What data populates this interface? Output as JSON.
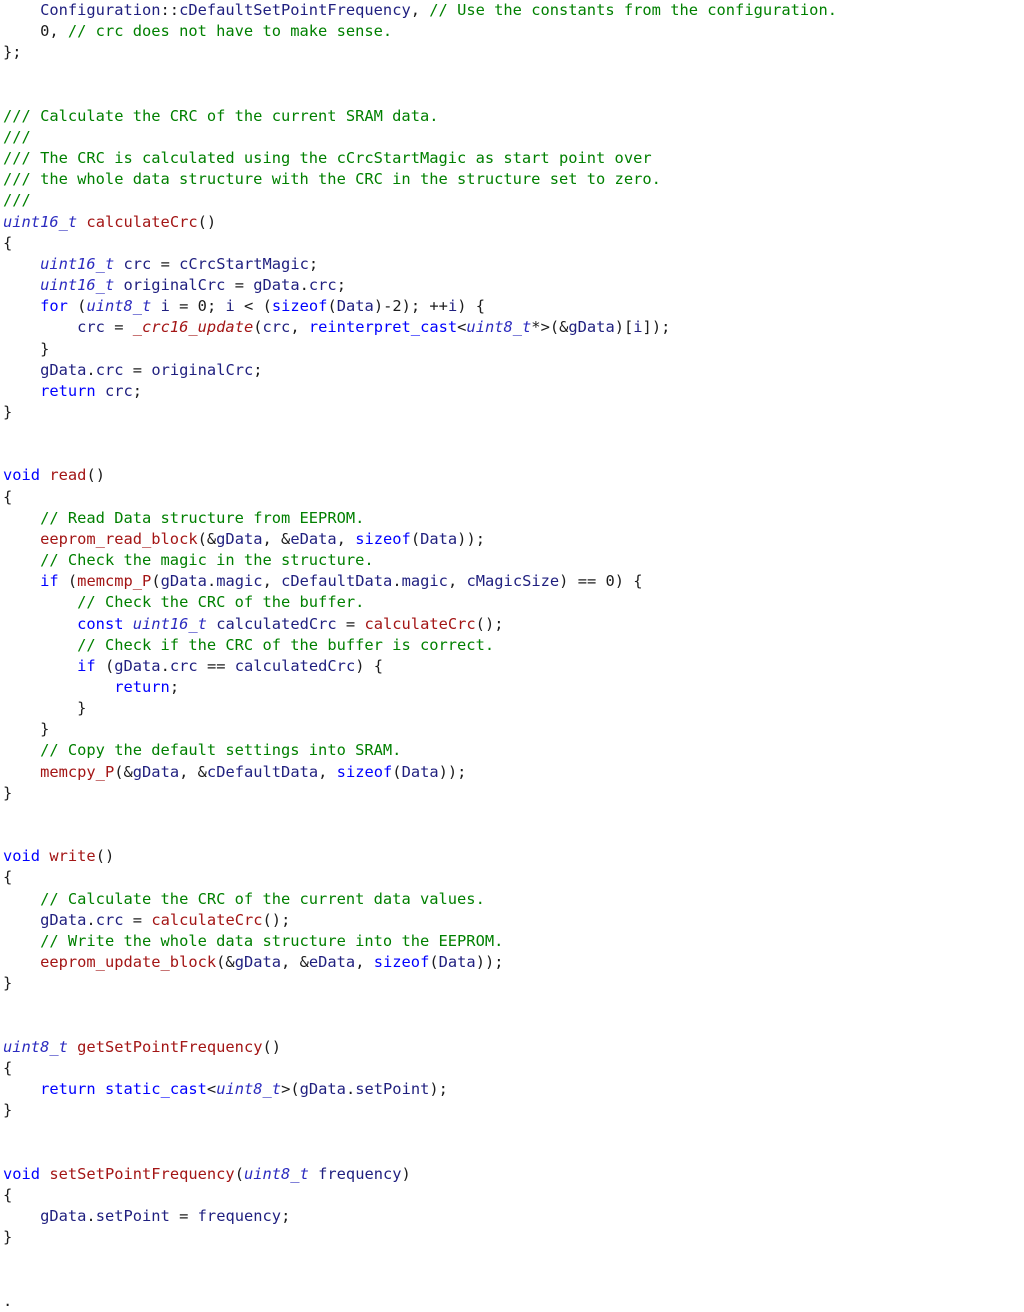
{
  "editor": {
    "title": "",
    "colors": {
      "plain": "#1c1c1c",
      "comment": "#008000",
      "keyword": "#0000ff",
      "type": "#2b2bbf",
      "function": "#a31515",
      "identifier": "#1f1f7f"
    },
    "lines": [
      [
        [
          "ident",
          "    Configuration"
        ],
        [
          "plain",
          "::"
        ],
        [
          "ident",
          "cDefaultSetPointFrequency"
        ],
        [
          "plain",
          ", "
        ],
        [
          "comment",
          "// Use the constants from the configuration."
        ]
      ],
      [
        [
          "plain",
          "    0, "
        ],
        [
          "comment",
          "// crc does not have to make sense."
        ]
      ],
      [
        [
          "plain",
          "};"
        ]
      ],
      [],
      [],
      [
        [
          "comment",
          "/// Calculate the CRC of the current SRAM data."
        ]
      ],
      [
        [
          "comment",
          "///"
        ]
      ],
      [
        [
          "comment",
          "/// The CRC is calculated using the cCrcStartMagic as start point over"
        ]
      ],
      [
        [
          "comment",
          "/// the whole data structure with the CRC in the structure set to zero."
        ]
      ],
      [
        [
          "comment",
          "///"
        ]
      ],
      [
        [
          "type",
          "uint16_t"
        ],
        [
          "plain",
          " "
        ],
        [
          "func",
          "calculateCrc"
        ],
        [
          "plain",
          "()"
        ]
      ],
      [
        [
          "plain",
          "{"
        ]
      ],
      [
        [
          "plain",
          "    "
        ],
        [
          "type",
          "uint16_t"
        ],
        [
          "plain",
          " "
        ],
        [
          "ident",
          "crc"
        ],
        [
          "plain",
          " = "
        ],
        [
          "ident",
          "cCrcStartMagic"
        ],
        [
          "plain",
          ";"
        ]
      ],
      [
        [
          "plain",
          "    "
        ],
        [
          "type",
          "uint16_t"
        ],
        [
          "plain",
          " "
        ],
        [
          "ident",
          "originalCrc"
        ],
        [
          "plain",
          " = "
        ],
        [
          "ident",
          "gData"
        ],
        [
          "plain",
          "."
        ],
        [
          "ident",
          "crc"
        ],
        [
          "plain",
          ";"
        ]
      ],
      [
        [
          "plain",
          "    "
        ],
        [
          "keyword",
          "for"
        ],
        [
          "plain",
          " ("
        ],
        [
          "type",
          "uint8_t"
        ],
        [
          "plain",
          " "
        ],
        [
          "ident",
          "i"
        ],
        [
          "plain",
          " = 0; "
        ],
        [
          "ident",
          "i"
        ],
        [
          "plain",
          " < ("
        ],
        [
          "keyword",
          "sizeof"
        ],
        [
          "plain",
          "("
        ],
        [
          "ident",
          "Data"
        ],
        [
          "plain",
          ")-2); ++"
        ],
        [
          "ident",
          "i"
        ],
        [
          "plain",
          ") {"
        ]
      ],
      [
        [
          "plain",
          "        "
        ],
        [
          "ident",
          "crc"
        ],
        [
          "plain",
          " = "
        ],
        [
          "funcit",
          "_crc16_update"
        ],
        [
          "plain",
          "("
        ],
        [
          "ident",
          "crc"
        ],
        [
          "plain",
          ", "
        ],
        [
          "keyword",
          "reinterpret_cast"
        ],
        [
          "plain",
          "<"
        ],
        [
          "type",
          "uint8_t"
        ],
        [
          "plain",
          "*>(&"
        ],
        [
          "ident",
          "gData"
        ],
        [
          "plain",
          ")["
        ],
        [
          "ident",
          "i"
        ],
        [
          "plain",
          "]);"
        ]
      ],
      [
        [
          "plain",
          "    }"
        ]
      ],
      [
        [
          "plain",
          "    "
        ],
        [
          "ident",
          "gData"
        ],
        [
          "plain",
          "."
        ],
        [
          "ident",
          "crc"
        ],
        [
          "plain",
          " = "
        ],
        [
          "ident",
          "originalCrc"
        ],
        [
          "plain",
          ";"
        ]
      ],
      [
        [
          "plain",
          "    "
        ],
        [
          "keyword",
          "return"
        ],
        [
          "plain",
          " "
        ],
        [
          "ident",
          "crc"
        ],
        [
          "plain",
          ";"
        ]
      ],
      [
        [
          "plain",
          "}"
        ]
      ],
      [],
      [],
      [
        [
          "keyword",
          "void"
        ],
        [
          "plain",
          " "
        ],
        [
          "func",
          "read"
        ],
        [
          "plain",
          "()"
        ]
      ],
      [
        [
          "plain",
          "{"
        ]
      ],
      [
        [
          "plain",
          "    "
        ],
        [
          "comment",
          "// Read Data structure from EEPROM."
        ]
      ],
      [
        [
          "plain",
          "    "
        ],
        [
          "func",
          "eeprom_read_block"
        ],
        [
          "plain",
          "(&"
        ],
        [
          "ident",
          "gData"
        ],
        [
          "plain",
          ", &"
        ],
        [
          "ident",
          "eData"
        ],
        [
          "plain",
          ", "
        ],
        [
          "keyword",
          "sizeof"
        ],
        [
          "plain",
          "("
        ],
        [
          "ident",
          "Data"
        ],
        [
          "plain",
          "));"
        ]
      ],
      [
        [
          "plain",
          "    "
        ],
        [
          "comment",
          "// Check the magic in the structure."
        ]
      ],
      [
        [
          "plain",
          "    "
        ],
        [
          "keyword",
          "if"
        ],
        [
          "plain",
          " ("
        ],
        [
          "func",
          "memcmp_P"
        ],
        [
          "plain",
          "("
        ],
        [
          "ident",
          "gData"
        ],
        [
          "plain",
          "."
        ],
        [
          "ident",
          "magic"
        ],
        [
          "plain",
          ", "
        ],
        [
          "ident",
          "cDefaultData"
        ],
        [
          "plain",
          "."
        ],
        [
          "ident",
          "magic"
        ],
        [
          "plain",
          ", "
        ],
        [
          "ident",
          "cMagicSize"
        ],
        [
          "plain",
          ") == 0) {"
        ]
      ],
      [
        [
          "plain",
          "        "
        ],
        [
          "comment",
          "// Check the CRC of the buffer."
        ]
      ],
      [
        [
          "plain",
          "        "
        ],
        [
          "keyword",
          "const"
        ],
        [
          "plain",
          " "
        ],
        [
          "type",
          "uint16_t"
        ],
        [
          "plain",
          " "
        ],
        [
          "ident",
          "calculatedCrc"
        ],
        [
          "plain",
          " = "
        ],
        [
          "func",
          "calculateCrc"
        ],
        [
          "plain",
          "();"
        ]
      ],
      [
        [
          "plain",
          "        "
        ],
        [
          "comment",
          "// Check if the CRC of the buffer is correct."
        ]
      ],
      [
        [
          "plain",
          "        "
        ],
        [
          "keyword",
          "if"
        ],
        [
          "plain",
          " ("
        ],
        [
          "ident",
          "gData"
        ],
        [
          "plain",
          "."
        ],
        [
          "ident",
          "crc"
        ],
        [
          "plain",
          " == "
        ],
        [
          "ident",
          "calculatedCrc"
        ],
        [
          "plain",
          ") {"
        ]
      ],
      [
        [
          "plain",
          "            "
        ],
        [
          "keyword",
          "return"
        ],
        [
          "plain",
          ";"
        ]
      ],
      [
        [
          "plain",
          "        }"
        ]
      ],
      [
        [
          "plain",
          "    }"
        ]
      ],
      [
        [
          "plain",
          "    "
        ],
        [
          "comment",
          "// Copy the default settings into SRAM."
        ]
      ],
      [
        [
          "plain",
          "    "
        ],
        [
          "func",
          "memcpy_P"
        ],
        [
          "plain",
          "(&"
        ],
        [
          "ident",
          "gData"
        ],
        [
          "plain",
          ", &"
        ],
        [
          "ident",
          "cDefaultData"
        ],
        [
          "plain",
          ", "
        ],
        [
          "keyword",
          "sizeof"
        ],
        [
          "plain",
          "("
        ],
        [
          "ident",
          "Data"
        ],
        [
          "plain",
          "));"
        ]
      ],
      [
        [
          "plain",
          "}"
        ]
      ],
      [],
      [],
      [
        [
          "keyword",
          "void"
        ],
        [
          "plain",
          " "
        ],
        [
          "func",
          "write"
        ],
        [
          "plain",
          "()"
        ]
      ],
      [
        [
          "plain",
          "{"
        ]
      ],
      [
        [
          "plain",
          "    "
        ],
        [
          "comment",
          "// Calculate the CRC of the current data values."
        ]
      ],
      [
        [
          "plain",
          "    "
        ],
        [
          "ident",
          "gData"
        ],
        [
          "plain",
          "."
        ],
        [
          "ident",
          "crc"
        ],
        [
          "plain",
          " = "
        ],
        [
          "func",
          "calculateCrc"
        ],
        [
          "plain",
          "();"
        ]
      ],
      [
        [
          "plain",
          "    "
        ],
        [
          "comment",
          "// Write the whole data structure into the EEPROM."
        ]
      ],
      [
        [
          "plain",
          "    "
        ],
        [
          "func",
          "eeprom_update_block"
        ],
        [
          "plain",
          "(&"
        ],
        [
          "ident",
          "gData"
        ],
        [
          "plain",
          ", &"
        ],
        [
          "ident",
          "eData"
        ],
        [
          "plain",
          ", "
        ],
        [
          "keyword",
          "sizeof"
        ],
        [
          "plain",
          "("
        ],
        [
          "ident",
          "Data"
        ],
        [
          "plain",
          "));"
        ]
      ],
      [
        [
          "plain",
          "}"
        ]
      ],
      [],
      [],
      [
        [
          "type",
          "uint8_t"
        ],
        [
          "plain",
          " "
        ],
        [
          "func",
          "getSetPointFrequency"
        ],
        [
          "plain",
          "()"
        ]
      ],
      [
        [
          "plain",
          "{"
        ]
      ],
      [
        [
          "plain",
          "    "
        ],
        [
          "keyword",
          "return"
        ],
        [
          "plain",
          " "
        ],
        [
          "keyword",
          "static_cast"
        ],
        [
          "plain",
          "<"
        ],
        [
          "type",
          "uint8_t"
        ],
        [
          "plain",
          ">("
        ],
        [
          "ident",
          "gData"
        ],
        [
          "plain",
          "."
        ],
        [
          "ident",
          "setPoint"
        ],
        [
          "plain",
          ");"
        ]
      ],
      [
        [
          "plain",
          "}"
        ]
      ],
      [],
      [],
      [
        [
          "keyword",
          "void"
        ],
        [
          "plain",
          " "
        ],
        [
          "func",
          "setSetPointFrequency"
        ],
        [
          "plain",
          "("
        ],
        [
          "type",
          "uint8_t"
        ],
        [
          "plain",
          " "
        ],
        [
          "ident",
          "frequency"
        ],
        [
          "plain",
          ")"
        ]
      ],
      [
        [
          "plain",
          "{"
        ]
      ],
      [
        [
          "plain",
          "    "
        ],
        [
          "ident",
          "gData"
        ],
        [
          "plain",
          "."
        ],
        [
          "ident",
          "setPoint"
        ],
        [
          "plain",
          " = "
        ],
        [
          "ident",
          "frequency"
        ],
        [
          "plain",
          ";"
        ]
      ],
      [
        [
          "plain",
          "}"
        ]
      ],
      [],
      [],
      [
        [
          "plain",
          "."
        ]
      ]
    ]
  }
}
